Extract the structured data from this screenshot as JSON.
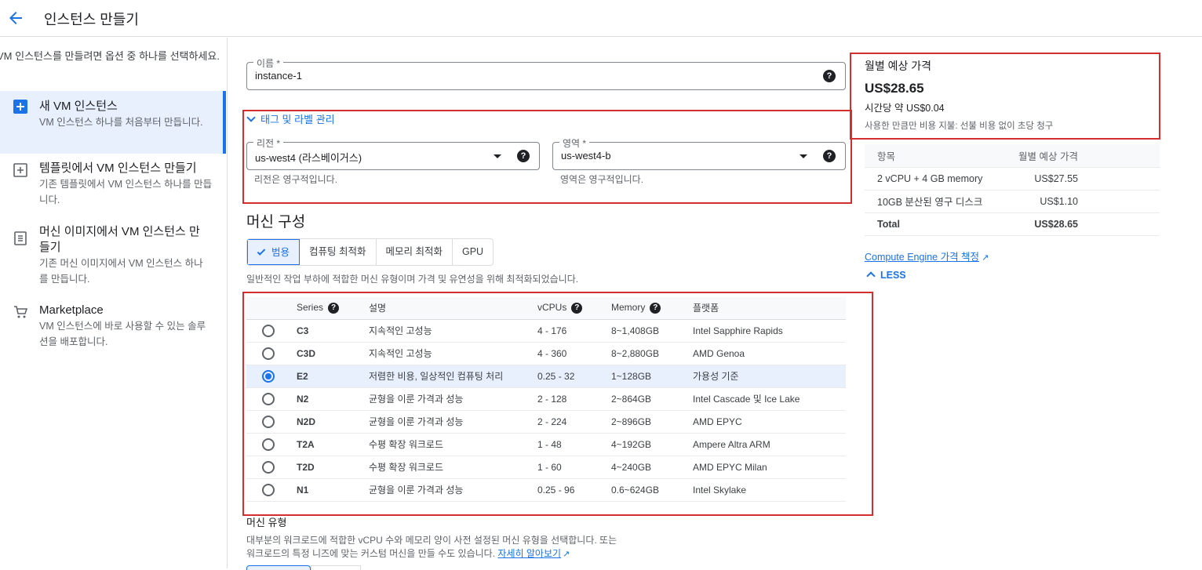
{
  "header": {
    "title": "인스턴스 만들기"
  },
  "sidebar": {
    "intro": "VM 인스턴스를 만들려면 옵션 중 하나를 선택하세요.",
    "items": [
      {
        "title": "새 VM 인스턴스",
        "desc": "VM 인스턴스 하나를 처음부터 만듭니다."
      },
      {
        "title": "템플릿에서 VM 인스턴스 만들기",
        "desc": "기존 템플릿에서 VM 인스턴스 하나를 만듭니다."
      },
      {
        "title": "머신 이미지에서 VM 인스턴스 만들기",
        "desc": "기존 머신 이미지에서 VM 인스턴스 하나를 만듭니다."
      },
      {
        "title": "Marketplace",
        "desc": "VM 인스턴스에 바로 사용할 수 있는 솔루션을 배포합니다."
      }
    ]
  },
  "form": {
    "name_label": "이름 *",
    "name_value": "instance-1",
    "tags_toggle": "태그 및 라벨 관리",
    "region_label": "리전 *",
    "region_value": "us-west4 (라스베이거스)",
    "region_hint": "리전은 영구적입니다.",
    "zone_label": "영역 *",
    "zone_value": "us-west4-b",
    "zone_hint": "영역은 영구적입니다."
  },
  "machine": {
    "heading": "머신 구성",
    "tabs": [
      "범용",
      "컴퓨팅 최적화",
      "메모리 최적화",
      "GPU"
    ],
    "description": "일반적인 작업 부하에 적합한 머신 유형이며 가격 및 유연성을 위해 최적화되었습니다.",
    "columns": [
      "Series",
      "설명",
      "vCPUs",
      "Memory",
      "플랫폼"
    ],
    "rows": [
      {
        "series": "C3",
        "desc": "지속적인 고성능",
        "vcpus": "4 - 176",
        "memory": "8~1,408GB",
        "platform": "Intel Sapphire Rapids"
      },
      {
        "series": "C3D",
        "desc": "지속적인 고성능",
        "vcpus": "4 - 360",
        "memory": "8~2,880GB",
        "platform": "AMD Genoa"
      },
      {
        "series": "E2",
        "desc": "저렴한 비용, 일상적인 컴퓨팅 처리",
        "vcpus": "0.25 - 32",
        "memory": "1~128GB",
        "platform": "가용성 기준"
      },
      {
        "series": "N2",
        "desc": "균형을 이룬 가격과 성능",
        "vcpus": "2 - 128",
        "memory": "2~864GB",
        "platform": "Intel Cascade 및 Ice Lake"
      },
      {
        "series": "N2D",
        "desc": "균형을 이룬 가격과 성능",
        "vcpus": "2 - 224",
        "memory": "2~896GB",
        "platform": "AMD EPYC"
      },
      {
        "series": "T2A",
        "desc": "수평 확장 워크로드",
        "vcpus": "1 - 48",
        "memory": "4~192GB",
        "platform": "Ampere Altra ARM"
      },
      {
        "series": "T2D",
        "desc": "수평 확장 워크로드",
        "vcpus": "1 - 60",
        "memory": "4~240GB",
        "platform": "AMD EPYC Milan"
      },
      {
        "series": "N1",
        "desc": "균형을 이룬 가격과 성능",
        "vcpus": "0.25 - 96",
        "memory": "0.6~624GB",
        "platform": "Intel Skylake"
      }
    ],
    "selected_series": "E2",
    "type_heading": "머신 유형",
    "type_desc_1": "대부분의 워크로드에 적합한 vCPU 수와 메모리 양이 사전 설정된 머신 유형을 선택합니다. 또는",
    "type_desc_2": "워크로드의 특정 니즈에 맞는 커스텀 머신을 만들 수도 있습니다.",
    "learn_more": "자세히 알아보기"
  },
  "pricing": {
    "heading": "월별 예상 가격",
    "monthly": "US$28.65",
    "hourly_prefix": "시간당 약 ",
    "hourly": "US$0.04",
    "note": "사용한 만큼만 비용 지불: 선불 비용 없이 초당 청구",
    "col_item": "항목",
    "col_cost": "월별 예상 가격",
    "lines": [
      {
        "item": "2 vCPU + 4 GB memory",
        "cost": "US$27.55"
      },
      {
        "item": "10GB 분산된 영구 디스크",
        "cost": "US$1.10"
      }
    ],
    "total_label": "Total",
    "total": "US$28.65",
    "link": "Compute Engine 가격 책정",
    "less": "LESS"
  },
  "colors": {
    "accent": "#1a73e8",
    "highlight": "#d32f2f"
  }
}
